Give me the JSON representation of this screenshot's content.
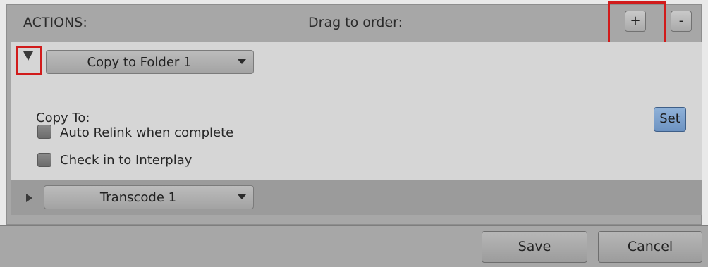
{
  "header": {
    "actions_label": "ACTIONS:",
    "drag_hint": "Drag to order:",
    "add_label": "+",
    "remove_label": "-"
  },
  "actions": [
    {
      "name": "Copy to Folder 1",
      "expanded": true,
      "copy_to_label": "Copy To:",
      "set_label": "Set",
      "options": [
        {
          "label": "Auto Relink when complete",
          "checked": false
        },
        {
          "label": "Check in to Interplay",
          "checked": false
        }
      ]
    },
    {
      "name": "Transcode 1",
      "expanded": false
    }
  ],
  "footer": {
    "save_label": "Save",
    "cancel_label": "Cancel"
  },
  "colors": {
    "highlight": "#d11b1b",
    "set_button": "#7aa0cd"
  }
}
